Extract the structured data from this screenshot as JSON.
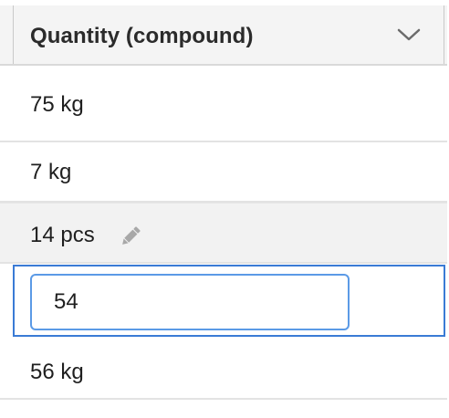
{
  "column": {
    "header_label": "Quantity (compound)",
    "menu_icon": "chevron-down-icon"
  },
  "rows": [
    {
      "value": "75 kg"
    },
    {
      "value": "7 kg"
    },
    {
      "value": "14 pcs",
      "hover_icon": "pencil-icon"
    },
    {
      "editor_value": "54"
    },
    {
      "value": "56 kg"
    }
  ],
  "colors": {
    "header_bg": "#f4f4f4",
    "hover_row_bg": "#f2f2f2",
    "focus_border": "#3a7bd5",
    "input_border": "#5b9ae6"
  }
}
